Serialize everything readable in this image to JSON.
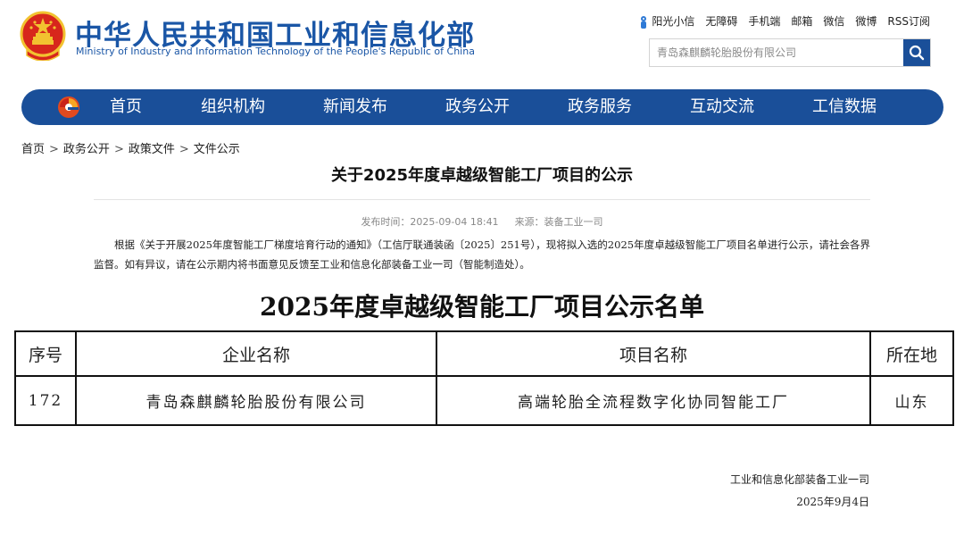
{
  "header": {
    "site_title": "中华人民共和国工业和信息化部",
    "site_subtitle": "Ministry of Industry and Information Technology of the People's Republic of China",
    "top_links": [
      "阳光小信",
      "无障碍",
      "手机端",
      "邮箱",
      "微信",
      "微博",
      "RSS订阅"
    ],
    "search": {
      "placeholder": "青岛森麒麟轮胎股份有限公司",
      "icon": "search-icon"
    }
  },
  "nav": {
    "items": [
      "首页",
      "组织机构",
      "新闻发布",
      "政务公开",
      "政务服务",
      "互动交流",
      "工信数据"
    ]
  },
  "breadcrumb": [
    "首页",
    "政务公开",
    "政策文件",
    "文件公示"
  ],
  "article": {
    "title": "关于2025年度卓越级智能工厂项目的公示",
    "publish_time": "发布时间：2025-09-04 18:41",
    "source": "来源：装备工业一司",
    "body": "根据《关于开展2025年度智能工厂梯度培育行动的通知》（工信厅联通装函〔2025〕251号），现将拟入选的2025年度卓越级智能工厂项目名单进行公示，请社会各界监督。如有异议，请在公示期内将书面意见反馈至工业和信息化部装备工业一司（智能制造处）。",
    "list_title": "2025年度卓越级智能工厂项目公示名单",
    "table": {
      "headers": [
        "序号",
        "企业名称",
        "项目名称",
        "所在地"
      ],
      "rows": [
        [
          "172",
          "青岛森麒麟轮胎股份有限公司",
          "高端轮胎全流程数字化协同智能工厂",
          "山东"
        ]
      ]
    },
    "signature": "工业和信息化部装备工业一司",
    "date": "2025年9月4日"
  },
  "colors": {
    "brand_blue": "#1a4f99",
    "title_blue": "#1a56a6",
    "emblem_red": "#d7261c",
    "emblem_gold": "#f2c230"
  }
}
